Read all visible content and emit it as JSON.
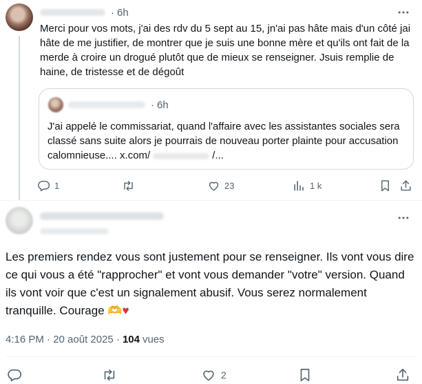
{
  "parent_tweet": {
    "time": "6h",
    "dot": "·",
    "text": "Merci pour vos mots, j'ai des rdv du 5 sept au 15, jn'ai pas hâte mais d'un côté jai hâte de me justifier, de montrer que je suis une bonne mère et qu'ils ont fait de la merde à croire un drogué plutôt que de mieux se renseigner. Jsuis remplie de haine, de tristesse et de dégoût",
    "quote": {
      "time": "6h",
      "dot": "·",
      "text": "J'ai appelé le commissariat, quand l'affaire avec les assistantes sociales sera classé sans suite alors je pourrais de nouveau porter plainte pour accusation calomnieuse.... x.com/",
      "link_tail": "/..."
    },
    "actions": {
      "replies": "1",
      "likes": "23",
      "views": "1 k"
    }
  },
  "focused_tweet": {
    "text": "Les premiers rendez vous sont justement pour se renseigner. Ils vont vous dire ce qui vous a été \"rapprocher\" et vont vous demander \"votre\" version. Quand ils vont voir que c'est un signalement abusif. Vous serez normalement tranquille. Courage ",
    "emoji_hands": "🫶",
    "emoji_heart": "♥",
    "time": "4:16 PM · 20 août 2025 · ",
    "views_count": "104",
    "views_label": "vues",
    "actions": {
      "likes": "2"
    }
  },
  "icons": [
    "more-icon",
    "reply-icon",
    "retweet-icon",
    "like-icon",
    "views-icon",
    "bookmark-icon",
    "share-icon"
  ],
  "colors": {
    "text": "#0f1419",
    "secondary": "#536471",
    "border": "#cfd9de",
    "heart": "#dd2e44"
  }
}
